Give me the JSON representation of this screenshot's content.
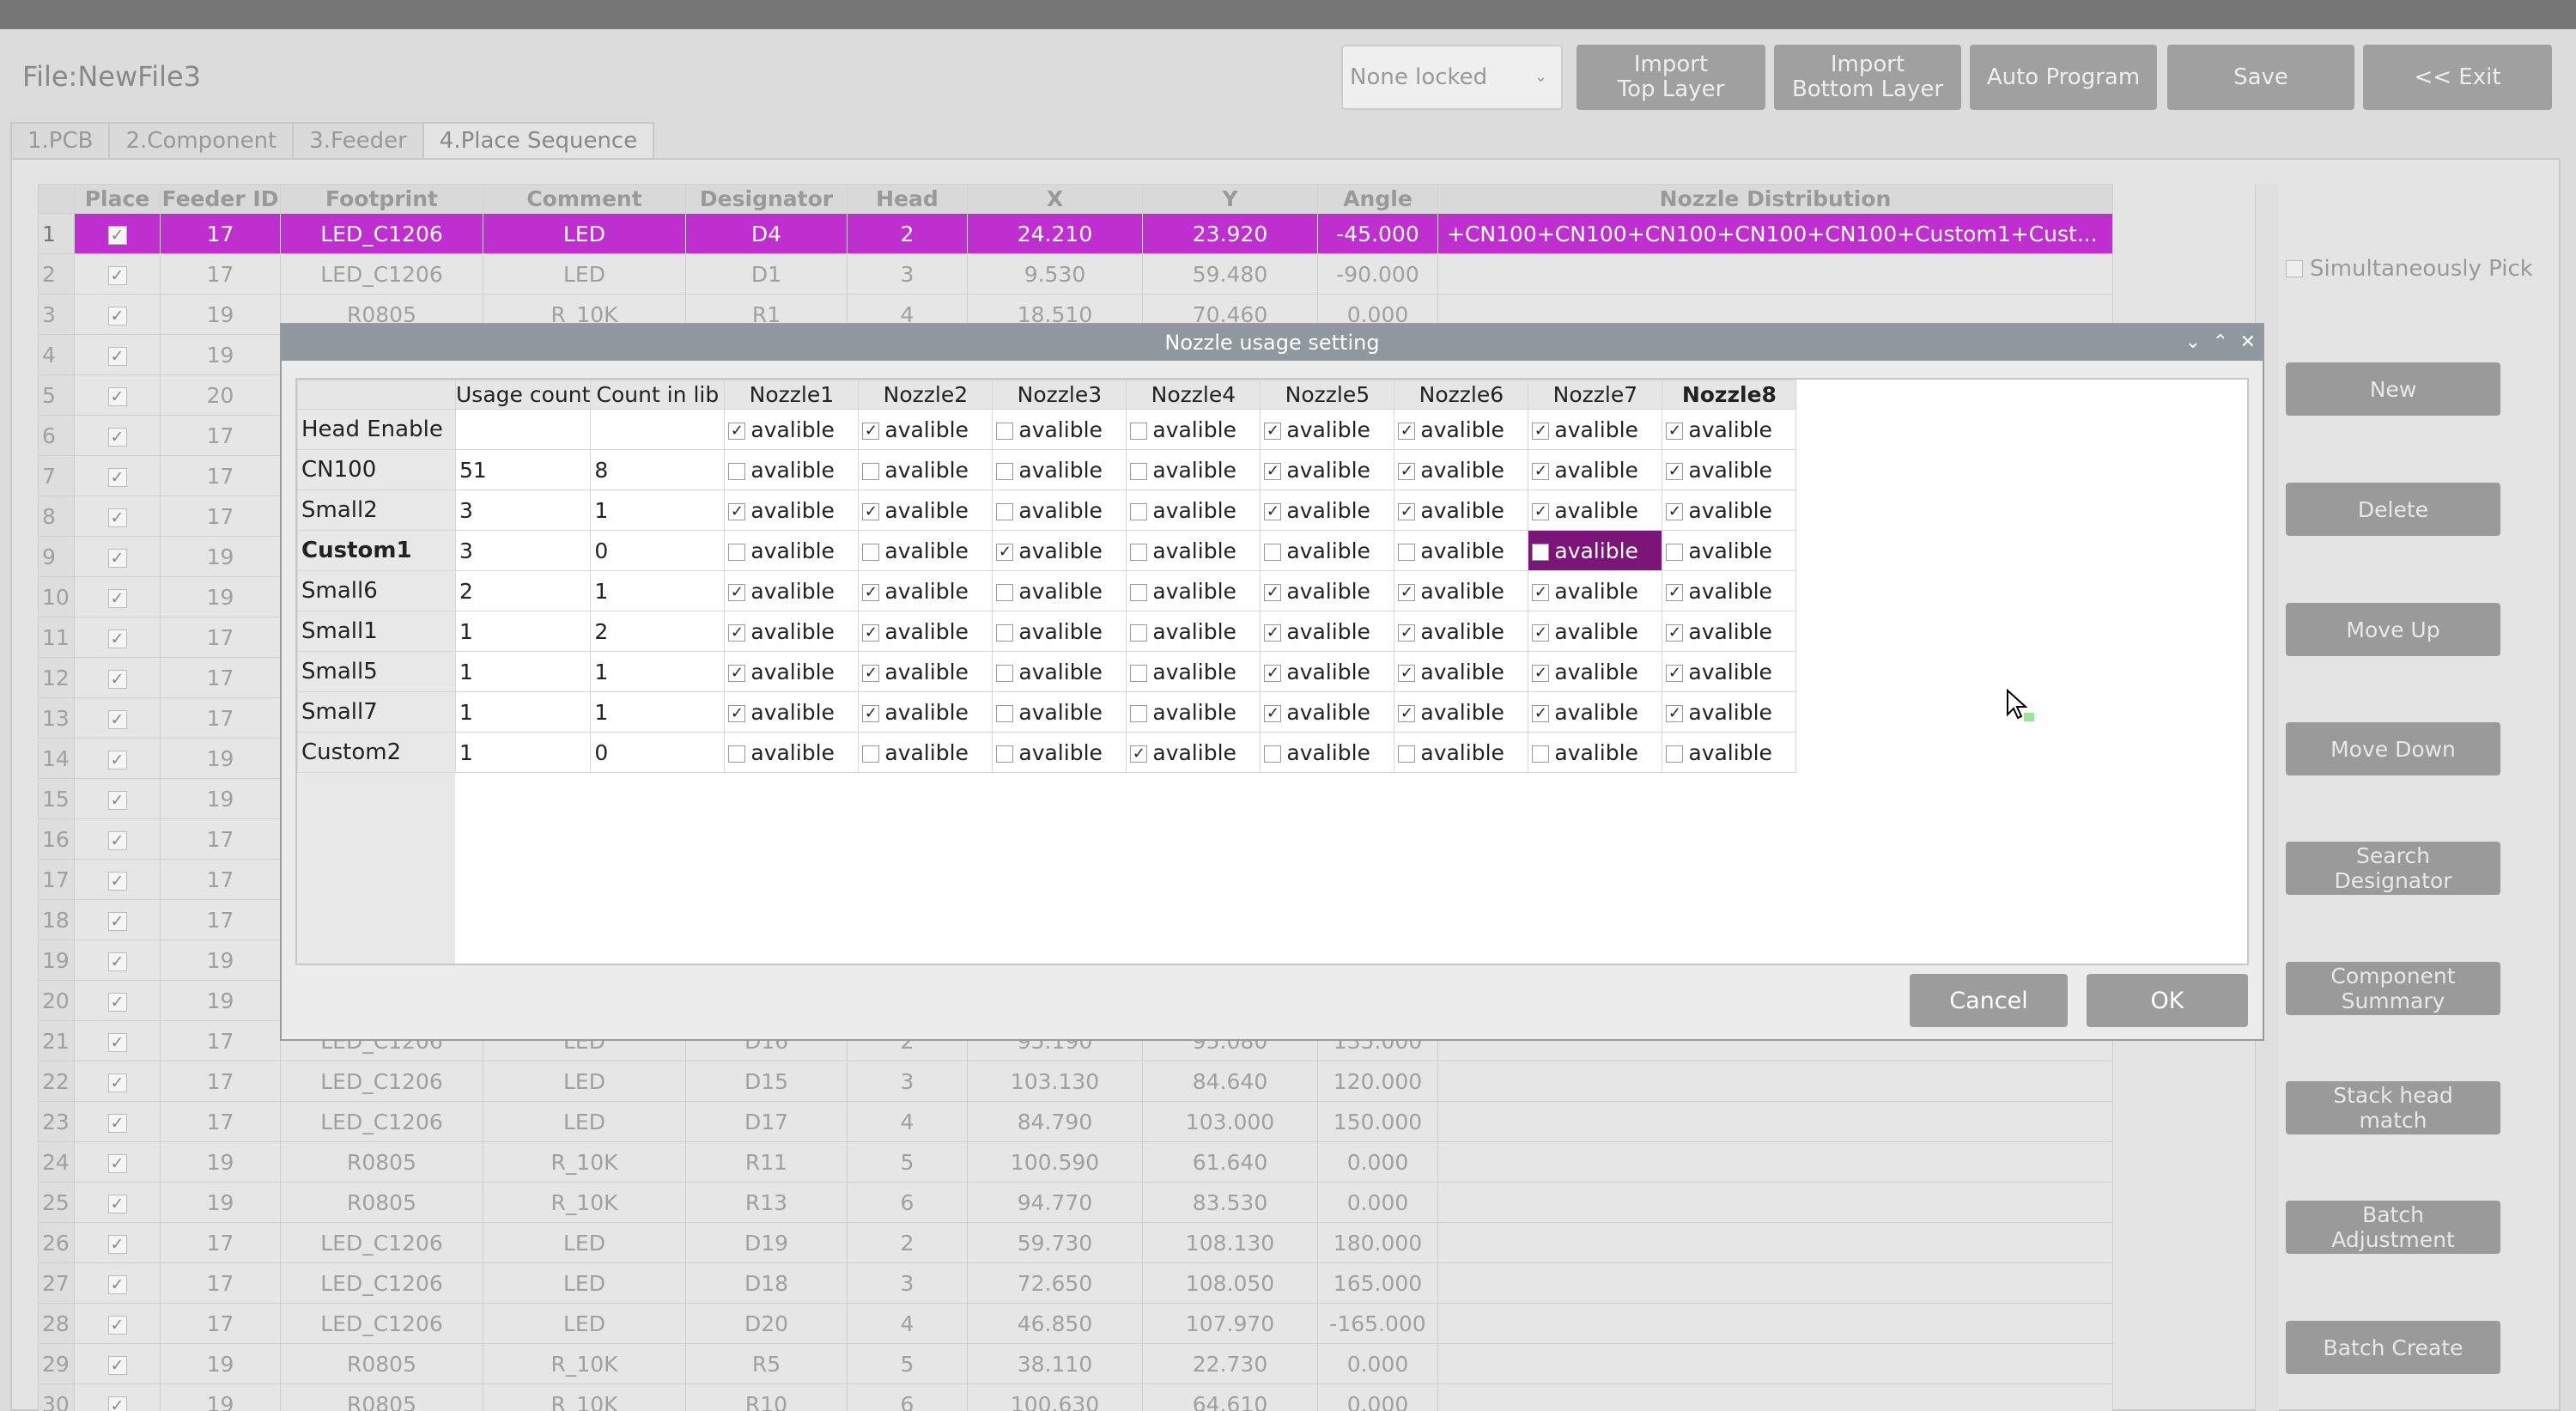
{
  "file": {
    "title": "File:NewFile3"
  },
  "toolbar": {
    "lock_value": "None locked",
    "import_top": "Import\nTop Layer",
    "import_bottom": "Import\nBottom Layer",
    "auto_program": "Auto Program",
    "save": "Save",
    "exit": "<< Exit"
  },
  "tabs": [
    "1.PCB",
    "2.Component",
    "3.Feeder",
    "4.Place Sequence"
  ],
  "main_table": {
    "headers": [
      "Place",
      "Feeder ID",
      "Footprint",
      "Comment",
      "Designator",
      "Head",
      "X",
      "Y",
      "Angle",
      "Nozzle Distribution"
    ],
    "selected_row": 1,
    "rows": [
      {
        "n": "1",
        "feeder": "17",
        "footprint": "LED_C1206",
        "comment": "LED",
        "designator": "D4",
        "head": "2",
        "x": "24.210",
        "y": "23.920",
        "angle": "-45.000",
        "nozzle": "+CN100+CN100+CN100+CN100+CN100+Custom1+Cust..."
      },
      {
        "n": "2",
        "feeder": "17",
        "footprint": "LED_C1206",
        "comment": "LED",
        "designator": "D1",
        "head": "3",
        "x": "9.530",
        "y": "59.480",
        "angle": "-90.000",
        "nozzle": ""
      },
      {
        "n": "3",
        "feeder": "19",
        "footprint": "R0805",
        "comment": "R_10K",
        "designator": "R1",
        "head": "4",
        "x": "18.510",
        "y": "70.460",
        "angle": "0.000",
        "nozzle": ""
      },
      {
        "n": "4",
        "feeder": "19",
        "footprint": "",
        "comment": "",
        "designator": "",
        "head": "",
        "x": "",
        "y": "",
        "angle": "",
        "nozzle": ""
      },
      {
        "n": "5",
        "feeder": "20",
        "footprint": "",
        "comment": "",
        "designator": "",
        "head": "",
        "x": "",
        "y": "",
        "angle": "",
        "nozzle": ""
      },
      {
        "n": "6",
        "feeder": "17",
        "footprint": "",
        "comment": "",
        "designator": "",
        "head": "",
        "x": "",
        "y": "",
        "angle": "",
        "nozzle": ""
      },
      {
        "n": "7",
        "feeder": "17",
        "footprint": "",
        "comment": "",
        "designator": "",
        "head": "",
        "x": "",
        "y": "",
        "angle": "",
        "nozzle": ""
      },
      {
        "n": "8",
        "feeder": "17",
        "footprint": "",
        "comment": "",
        "designator": "",
        "head": "",
        "x": "",
        "y": "",
        "angle": "",
        "nozzle": ""
      },
      {
        "n": "9",
        "feeder": "19",
        "footprint": "",
        "comment": "",
        "designator": "",
        "head": "",
        "x": "",
        "y": "",
        "angle": "",
        "nozzle": ""
      },
      {
        "n": "10",
        "feeder": "19",
        "footprint": "",
        "comment": "",
        "designator": "",
        "head": "",
        "x": "",
        "y": "",
        "angle": "",
        "nozzle": ""
      },
      {
        "n": "11",
        "feeder": "17",
        "footprint": "",
        "comment": "",
        "designator": "",
        "head": "",
        "x": "",
        "y": "",
        "angle": "",
        "nozzle": ""
      },
      {
        "n": "12",
        "feeder": "17",
        "footprint": "",
        "comment": "",
        "designator": "",
        "head": "",
        "x": "",
        "y": "",
        "angle": "",
        "nozzle": ""
      },
      {
        "n": "13",
        "feeder": "17",
        "footprint": "",
        "comment": "",
        "designator": "",
        "head": "",
        "x": "",
        "y": "",
        "angle": "",
        "nozzle": ""
      },
      {
        "n": "14",
        "feeder": "19",
        "footprint": "",
        "comment": "",
        "designator": "",
        "head": "",
        "x": "",
        "y": "",
        "angle": "",
        "nozzle": ""
      },
      {
        "n": "15",
        "feeder": "19",
        "footprint": "",
        "comment": "",
        "designator": "",
        "head": "",
        "x": "",
        "y": "",
        "angle": "",
        "nozzle": ""
      },
      {
        "n": "16",
        "feeder": "17",
        "footprint": "",
        "comment": "",
        "designator": "",
        "head": "",
        "x": "",
        "y": "",
        "angle": "",
        "nozzle": ""
      },
      {
        "n": "17",
        "feeder": "17",
        "footprint": "",
        "comment": "",
        "designator": "",
        "head": "",
        "x": "",
        "y": "",
        "angle": "",
        "nozzle": ""
      },
      {
        "n": "18",
        "feeder": "17",
        "footprint": "",
        "comment": "",
        "designator": "",
        "head": "",
        "x": "",
        "y": "",
        "angle": "",
        "nozzle": ""
      },
      {
        "n": "19",
        "feeder": "19",
        "footprint": "",
        "comment": "",
        "designator": "",
        "head": "",
        "x": "",
        "y": "",
        "angle": "",
        "nozzle": ""
      },
      {
        "n": "20",
        "feeder": "19",
        "footprint": "",
        "comment": "",
        "designator": "",
        "head": "",
        "x": "",
        "y": "",
        "angle": "",
        "nozzle": ""
      },
      {
        "n": "21",
        "feeder": "17",
        "footprint": "LED_C1206",
        "comment": "LED",
        "designator": "D16",
        "head": "2",
        "x": "95.190",
        "y": "95.080",
        "angle": "135.000",
        "nozzle": ""
      },
      {
        "n": "22",
        "feeder": "17",
        "footprint": "LED_C1206",
        "comment": "LED",
        "designator": "D15",
        "head": "3",
        "x": "103.130",
        "y": "84.640",
        "angle": "120.000",
        "nozzle": ""
      },
      {
        "n": "23",
        "feeder": "17",
        "footprint": "LED_C1206",
        "comment": "LED",
        "designator": "D17",
        "head": "4",
        "x": "84.790",
        "y": "103.000",
        "angle": "150.000",
        "nozzle": ""
      },
      {
        "n": "24",
        "feeder": "19",
        "footprint": "R0805",
        "comment": "R_10K",
        "designator": "R11",
        "head": "5",
        "x": "100.590",
        "y": "61.640",
        "angle": "0.000",
        "nozzle": ""
      },
      {
        "n": "25",
        "feeder": "19",
        "footprint": "R0805",
        "comment": "R_10K",
        "designator": "R13",
        "head": "6",
        "x": "94.770",
        "y": "83.530",
        "angle": "0.000",
        "nozzle": ""
      },
      {
        "n": "26",
        "feeder": "17",
        "footprint": "LED_C1206",
        "comment": "LED",
        "designator": "D19",
        "head": "2",
        "x": "59.730",
        "y": "108.130",
        "angle": "180.000",
        "nozzle": ""
      },
      {
        "n": "27",
        "feeder": "17",
        "footprint": "LED_C1206",
        "comment": "LED",
        "designator": "D18",
        "head": "3",
        "x": "72.650",
        "y": "108.050",
        "angle": "165.000",
        "nozzle": ""
      },
      {
        "n": "28",
        "feeder": "17",
        "footprint": "LED_C1206",
        "comment": "LED",
        "designator": "D20",
        "head": "4",
        "x": "46.850",
        "y": "107.970",
        "angle": "-165.000",
        "nozzle": ""
      },
      {
        "n": "29",
        "feeder": "19",
        "footprint": "R0805",
        "comment": "R_10K",
        "designator": "R5",
        "head": "5",
        "x": "38.110",
        "y": "22.730",
        "angle": "0.000",
        "nozzle": ""
      },
      {
        "n": "30",
        "feeder": "19",
        "footprint": "R0805",
        "comment": "R_10K",
        "designator": "R10",
        "head": "6",
        "x": "100.630",
        "y": "64.610",
        "angle": "0.000",
        "nozzle": ""
      }
    ]
  },
  "side": {
    "simultaneous_pick": "Simultaneously Pick",
    "buttons": [
      "New",
      "Delete",
      "Move Up",
      "Move Down",
      "Search\nDesignator",
      "Component\nSummary",
      "Stack head\nmatch",
      "Batch\nAdjustment",
      "Batch Create"
    ]
  },
  "dialog": {
    "title": "Nozzle usage setting",
    "headers": [
      "",
      "Usage count",
      "Count in lib",
      "Nozzle1",
      "Nozzle2",
      "Nozzle3",
      "Nozzle4",
      "Nozzle5",
      "Nozzle6",
      "Nozzle7",
      "Nozzle8"
    ],
    "bold_header_index": 9,
    "cell_text": "avalible",
    "rows": [
      {
        "name": "Head Enable",
        "usage": "",
        "lib": "",
        "checks": [
          true,
          true,
          false,
          false,
          true,
          true,
          true,
          true
        ],
        "bold": false
      },
      {
        "name": "CN100",
        "usage": "51",
        "lib": "8",
        "checks": [
          false,
          false,
          false,
          false,
          true,
          true,
          true,
          true
        ],
        "bold": false
      },
      {
        "name": "Small2",
        "usage": "3",
        "lib": "1",
        "checks": [
          true,
          true,
          false,
          false,
          true,
          true,
          true,
          true
        ],
        "bold": false
      },
      {
        "name": "Custom1",
        "usage": "3",
        "lib": "0",
        "checks": [
          false,
          false,
          true,
          false,
          false,
          false,
          false,
          false
        ],
        "bold": true,
        "highlight_col": 6
      },
      {
        "name": "Small6",
        "usage": "2",
        "lib": "1",
        "checks": [
          true,
          true,
          false,
          false,
          true,
          true,
          true,
          true
        ],
        "bold": false
      },
      {
        "name": "Small1",
        "usage": "1",
        "lib": "2",
        "checks": [
          true,
          true,
          false,
          false,
          true,
          true,
          true,
          true
        ],
        "bold": false
      },
      {
        "name": "Small5",
        "usage": "1",
        "lib": "1",
        "checks": [
          true,
          true,
          false,
          false,
          true,
          true,
          true,
          true
        ],
        "bold": false
      },
      {
        "name": "Small7",
        "usage": "1",
        "lib": "1",
        "checks": [
          true,
          true,
          false,
          false,
          true,
          true,
          true,
          true
        ],
        "bold": false
      },
      {
        "name": "Custom2",
        "usage": "1",
        "lib": "0",
        "checks": [
          false,
          false,
          false,
          true,
          false,
          false,
          false,
          false
        ],
        "bold": false
      }
    ],
    "cancel": "Cancel",
    "ok": "OK"
  }
}
